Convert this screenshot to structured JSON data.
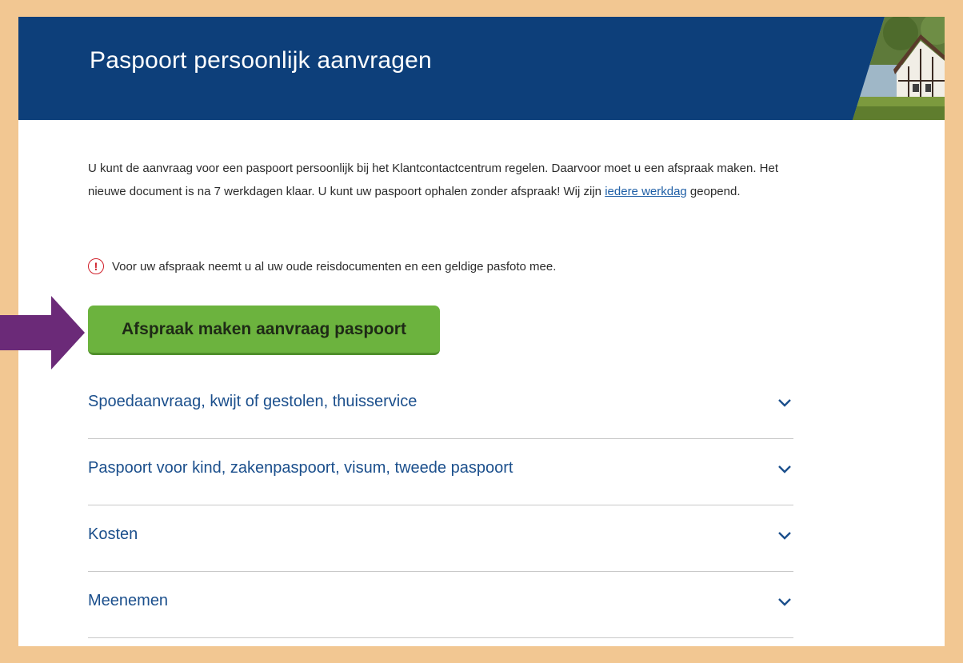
{
  "banner": {
    "title": "Paspoort persoonlijk aanvragen"
  },
  "intro": {
    "text_before_link": "U kunt de aanvraag voor een paspoort persoonlijk bij het Klantcontactcentrum regelen. Daarvoor moet u een afspraak maken. Het nieuwe document is na 7 werkdagen klaar. U kunt uw paspoort ophalen zonder afspraak! Wij zijn ",
    "link_text": "iedere werkdag",
    "text_after_link": " geopend."
  },
  "notice": {
    "icon_symbol": "!",
    "text": "Voor uw afspraak neemt u al uw oude reisdocumenten en een geldige pasfoto mee."
  },
  "cta": {
    "label": "Afspraak maken aanvraag paspoort"
  },
  "accordion": {
    "items": [
      {
        "label": "Spoedaanvraag, kwijt of gestolen, thuisservice"
      },
      {
        "label": "Paspoort voor kind, zakenpaspoort, visum, tweede paspoort"
      },
      {
        "label": "Kosten"
      },
      {
        "label": "Meenemen"
      }
    ]
  },
  "colors": {
    "frame_background": "#F2C792",
    "banner_background": "#0D3F7A",
    "cta_green": "#6CB33E",
    "link_blue": "#1B4F8C",
    "alert_red": "#D0202A",
    "arrow_purple": "#6B2A78"
  },
  "icons": {
    "notice": "exclamation-circle-icon",
    "accordion": "chevron-down-icon",
    "pointer": "arrow-right-icon"
  }
}
